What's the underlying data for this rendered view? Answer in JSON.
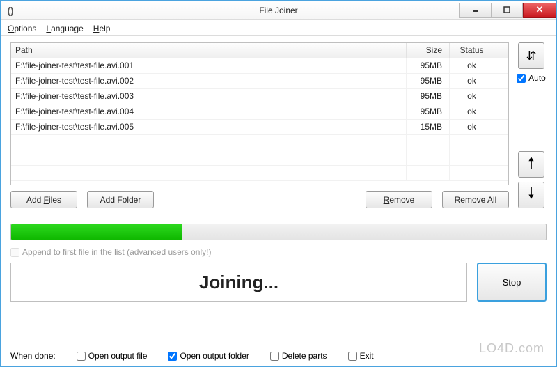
{
  "window": {
    "title": "File Joiner",
    "icon_glyph": "()"
  },
  "menu": {
    "options": "Options",
    "language": "Language",
    "help": "Help"
  },
  "list": {
    "headers": {
      "path": "Path",
      "size": "Size",
      "status": "Status"
    },
    "rows": [
      {
        "path": "F:\\file-joiner-test\\test-file.avi.001",
        "size": "95MB",
        "status": "ok"
      },
      {
        "path": "F:\\file-joiner-test\\test-file.avi.002",
        "size": "95MB",
        "status": "ok"
      },
      {
        "path": "F:\\file-joiner-test\\test-file.avi.003",
        "size": "95MB",
        "status": "ok"
      },
      {
        "path": "F:\\file-joiner-test\\test-file.avi.004",
        "size": "95MB",
        "status": "ok"
      },
      {
        "path": "F:\\file-joiner-test\\test-file.avi.005",
        "size": "15MB",
        "status": "ok"
      }
    ]
  },
  "buttons": {
    "add_files": "Add Files",
    "add_folder": "Add Folder",
    "remove": "Remove",
    "remove_all": "Remove All",
    "stop": "Stop"
  },
  "side": {
    "auto_label": "Auto",
    "auto_checked": true
  },
  "progress_percent": 32,
  "append_label": "Append to first file in the list (advanced users only!)",
  "status_text": "Joining...",
  "bottom": {
    "when_done": "When done:",
    "open_file": "Open output file",
    "open_folder": "Open output folder",
    "open_folder_checked": true,
    "delete_parts": "Delete parts",
    "exit": "Exit"
  },
  "watermark": "LO4D.com"
}
